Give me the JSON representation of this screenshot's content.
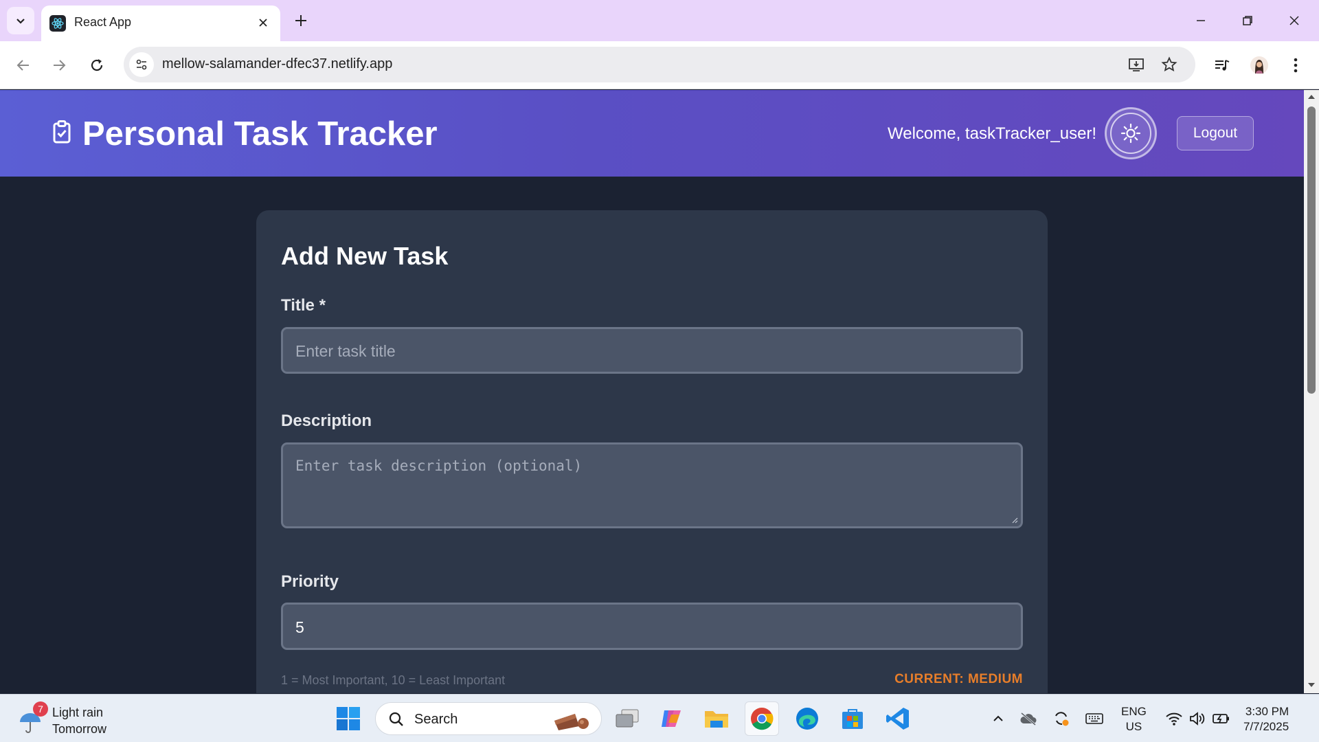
{
  "browser": {
    "tab_title": "React App",
    "url": "mellow-salamander-dfec37.netlify.app"
  },
  "app": {
    "title": "Personal Task Tracker",
    "welcome": "Welcome, taskTracker_user!",
    "logout_label": "Logout"
  },
  "form": {
    "heading": "Add New Task",
    "title_label": "Title *",
    "title_placeholder": "Enter task title",
    "description_label": "Description",
    "description_placeholder": "Enter task description (optional)",
    "priority_label": "Priority",
    "priority_value": "5",
    "priority_hint": "1 = Most Important, 10 = Least Important",
    "priority_current": "CURRENT: MEDIUM"
  },
  "taskbar": {
    "weather_badge": "7",
    "weather_line1": "Light rain",
    "weather_line2": "Tomorrow",
    "search_label": "Search",
    "lang_line1": "ENG",
    "lang_line2": "US",
    "time": "3:30 PM",
    "date": "7/7/2025"
  },
  "colors": {
    "header_gradient_start": "#5b5fd4",
    "header_gradient_end": "#6548bd",
    "page_background": "#1b2232",
    "card_background": "#2d3749",
    "accent_orange": "#e87e2a"
  }
}
